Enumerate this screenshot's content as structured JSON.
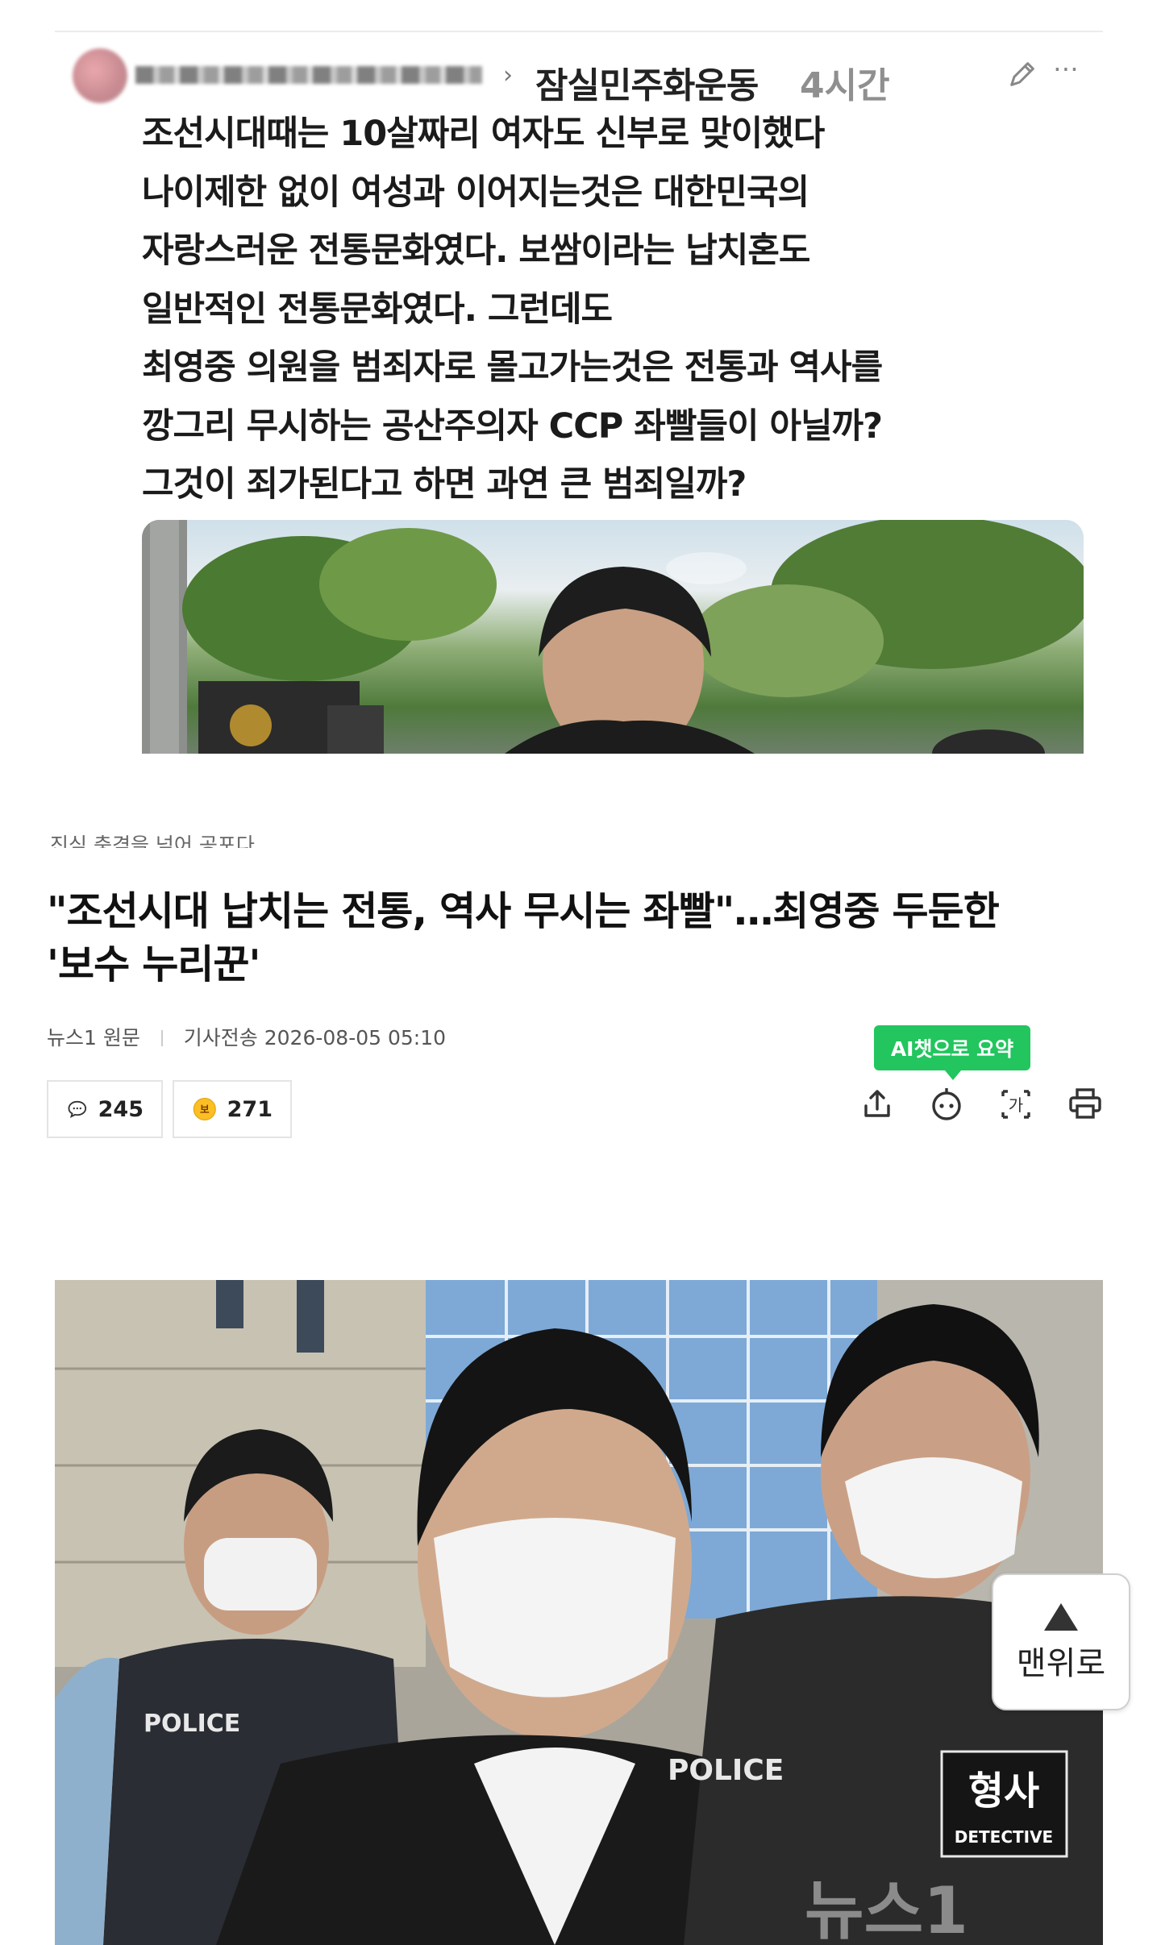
{
  "post": {
    "community": "잠실민주화운동",
    "time": "4시간",
    "lines": [
      "조선시대때는 10살짜리 여자도 신부로 맞이했다",
      "나이제한 없이 여성과 이어지는것은 대한민국의",
      "자랑스러운 전통문화였다. 보쌈이라는 납치혼도",
      "일반적인 전통문화였다. 그런데도",
      "최영중 의원을 범죄자로 몰고가는것은 전통과 역사를",
      "깡그리 무시하는 공산주의자 CCP 좌빨들이 아닐까?",
      "그것이 죄가된다고 하면 과연 큰 범죄일까?"
    ]
  },
  "article": {
    "kicker": "진심 충격을 넘어 공포다",
    "title_line1": "\"조선시대 납치는 전통, 역사 무시는 좌빨\"…최영중 두둔한",
    "title_line2": "'보수 누리꾼'",
    "source": "뉴스1",
    "source_link": "원문",
    "sent_label": "기사전송",
    "sent_time": "2026-08-05 05:10",
    "comment_count": "245",
    "reaction_count": "271",
    "reaction_badge": "보",
    "ai_badge": "AI챗으로 요약"
  },
  "photo": {
    "vest_left": "POLICE",
    "vest_right": "POLICE",
    "detective_patch": "형사",
    "detective_sub": "DETECTIVE",
    "watermark": "뉴스1"
  },
  "top_button": {
    "label": "맨위로"
  },
  "colors": {
    "accent_green": "#22c55e",
    "text": "#111111",
    "muted": "#8f8f8f"
  }
}
